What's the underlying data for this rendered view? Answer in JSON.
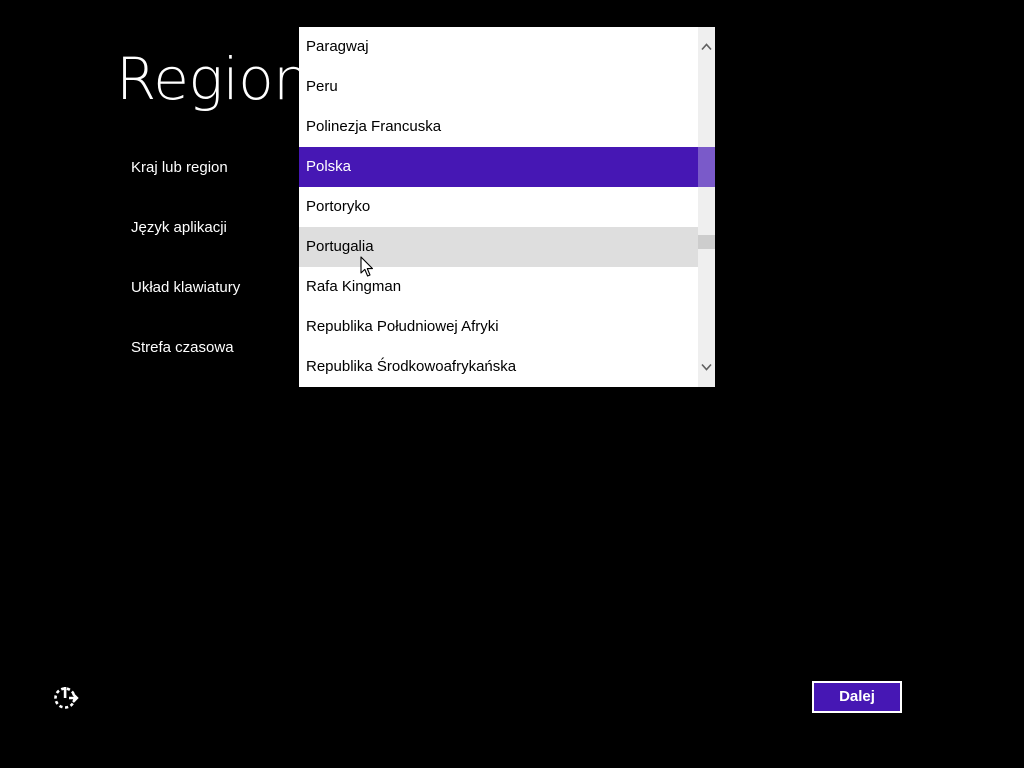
{
  "page": {
    "title": "Region"
  },
  "settings": {
    "labels": [
      "Kraj lub region",
      "Język aplikacji",
      "Układ klawiatury",
      "Strefa czasowa"
    ]
  },
  "country_dropdown": {
    "items": [
      "Paragwaj",
      "Peru",
      "Polinezja Francuska",
      "Polska",
      "Portoryko",
      "Portugalia",
      "Rafa Kingman",
      "Republika Południowej Afryki",
      "Republika Środkowoafrykańska"
    ],
    "selected": "Polska",
    "hovered": "Portugalia"
  },
  "footer": {
    "next_label": "Dalej"
  },
  "colors": {
    "background": "#000000",
    "accent": "#4617b4",
    "hover": "#dedede",
    "text_light": "#ffffff"
  },
  "icons": {
    "scroll_up": "chevron-up-icon",
    "scroll_down": "chevron-down-icon",
    "accessibility": "ease-of-access-icon",
    "pointer": "mouse-cursor-icon"
  }
}
